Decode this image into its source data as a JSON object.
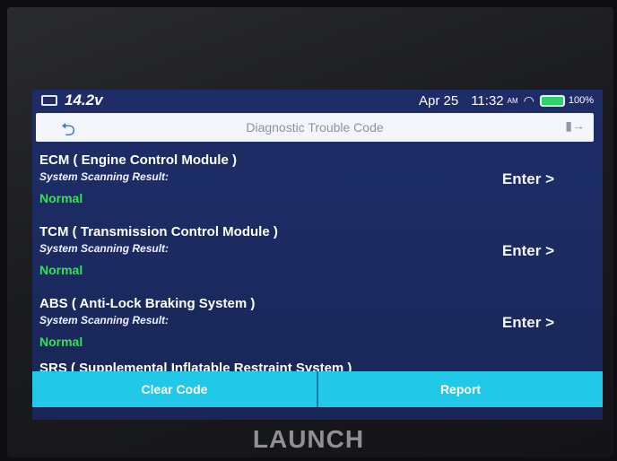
{
  "status_bar": {
    "voltage": "14.2v",
    "date": "Apr 25",
    "time": "11:32",
    "ampm": "AM",
    "battery": "100%"
  },
  "header": {
    "title": "Diagnostic Trouble Code"
  },
  "systems": [
    {
      "name": "ECM ( Engine Control Module )",
      "label": "System Scanning Result:",
      "status": "Normal",
      "action": "Enter >"
    },
    {
      "name": "TCM ( Transmission Control Module )",
      "label": "System Scanning Result:",
      "status": "Normal",
      "action": "Enter >"
    },
    {
      "name": "ABS ( Anti-Lock Braking System )",
      "label": "System Scanning Result:",
      "status": "Normal",
      "action": "Enter >"
    },
    {
      "name": "SRS ( Supplemental Inflatable Restraint System )"
    }
  ],
  "footer": {
    "clear_label": "Clear Code",
    "report_label": "Report"
  },
  "device": {
    "brand": "LAUNCH"
  },
  "colors": {
    "screen_bg": "#1e2d68",
    "status_ok": "#2ee84a",
    "button_bg": "#22c8e8"
  },
  "icons": [
    "car-icon",
    "wifi-icon",
    "battery-icon",
    "back-icon",
    "exit-icon"
  ]
}
